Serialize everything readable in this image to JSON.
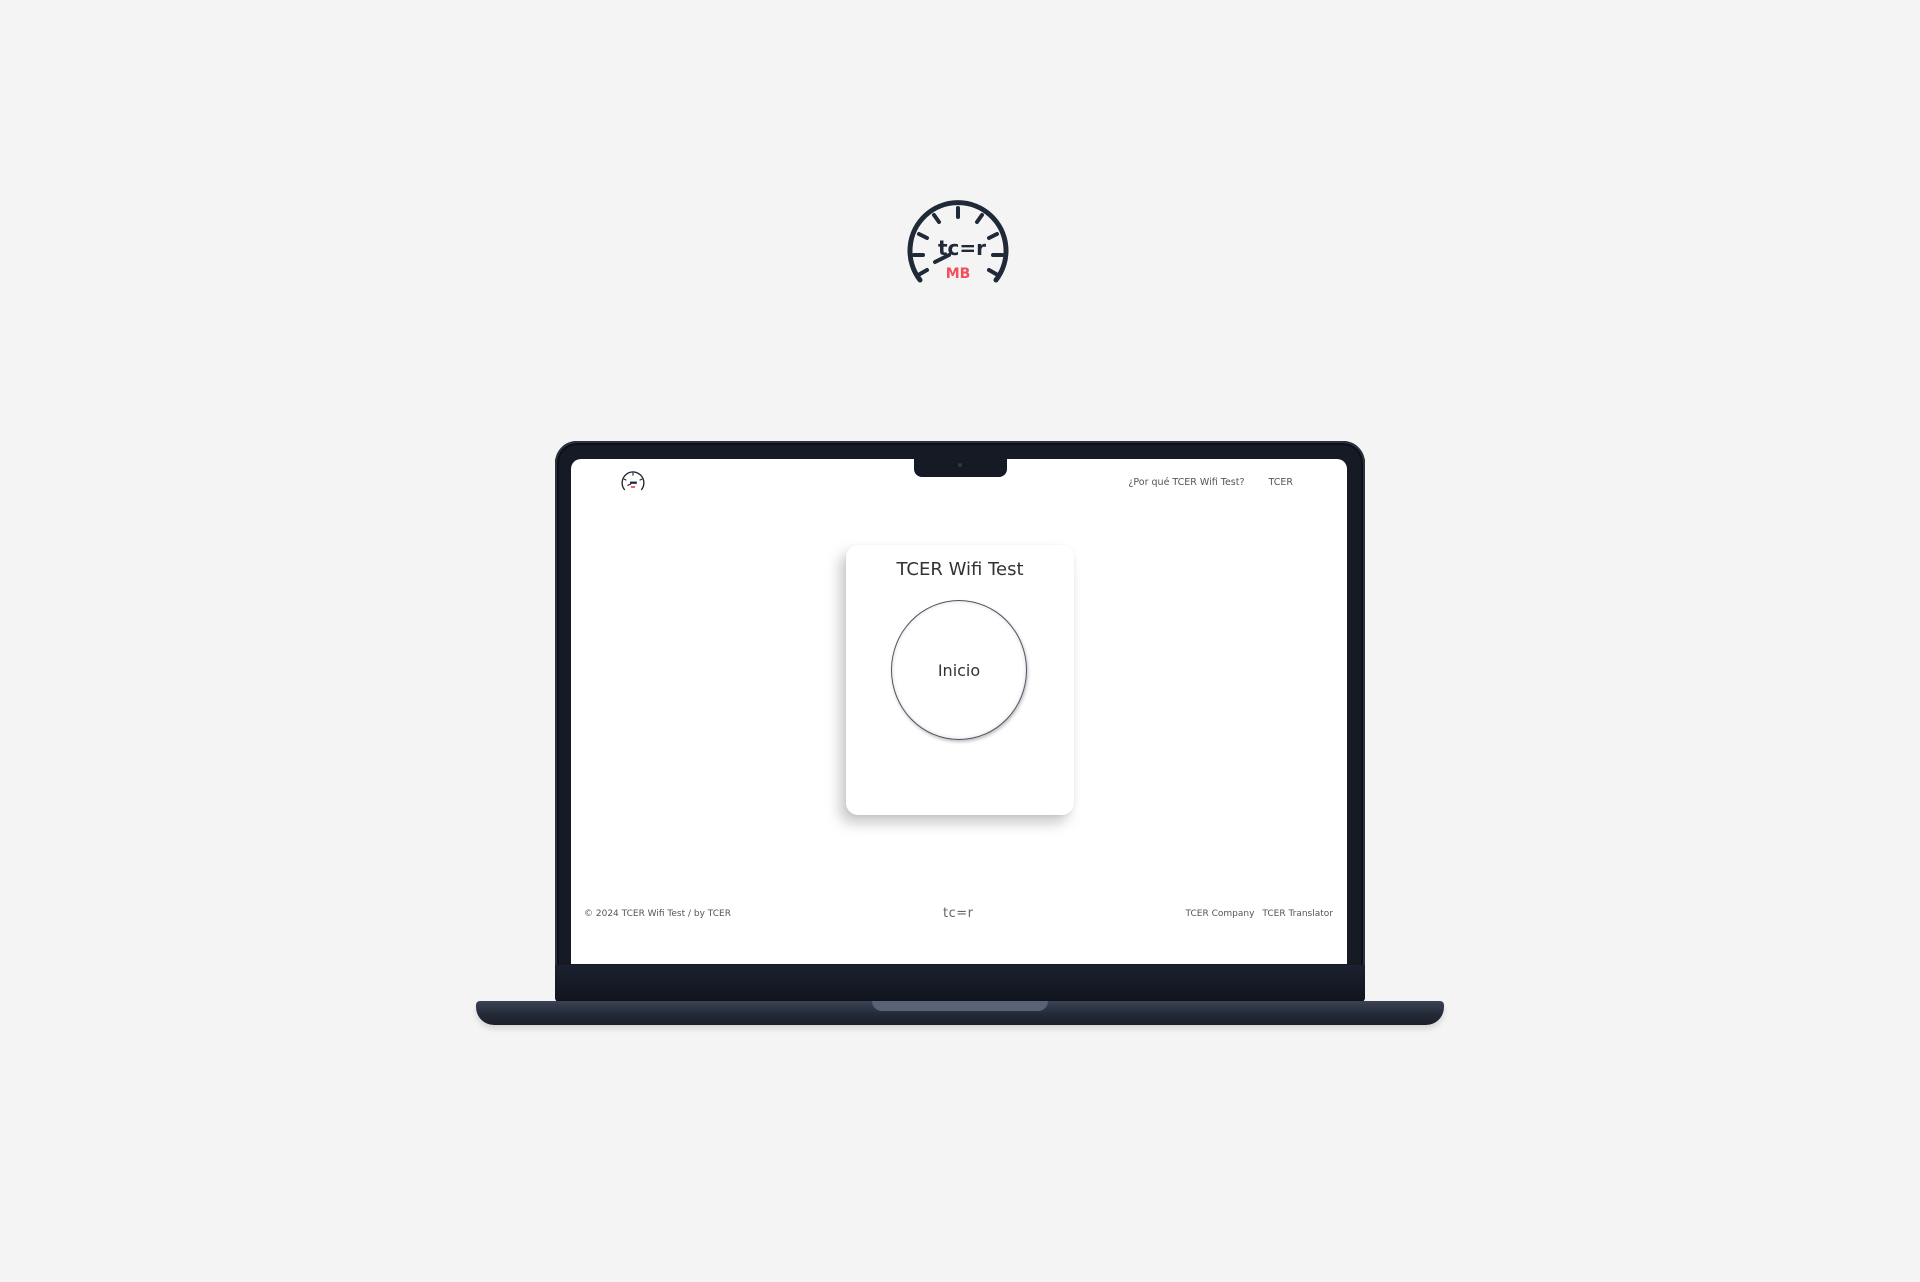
{
  "hero": {
    "logo_icon": "speedometer-logo-icon",
    "logo_text": "tc=r",
    "logo_badge": "MB",
    "badge_color": "#f0505a",
    "ink_color": "#1f2937"
  },
  "header": {
    "logo_icon": "speedometer-logo-icon",
    "nav": [
      {
        "label": "¿Por qué TCER Wifi Test?"
      },
      {
        "label": "TCER"
      }
    ]
  },
  "card": {
    "title": "TCER Wifi Test",
    "button_label": "Inicio"
  },
  "footer": {
    "copyright": "© 2024 TCER Wifi Test / by TCER",
    "brand": "tc=r",
    "links": [
      {
        "label": "TCER Company"
      },
      {
        "label": "TCER Translator"
      }
    ]
  }
}
